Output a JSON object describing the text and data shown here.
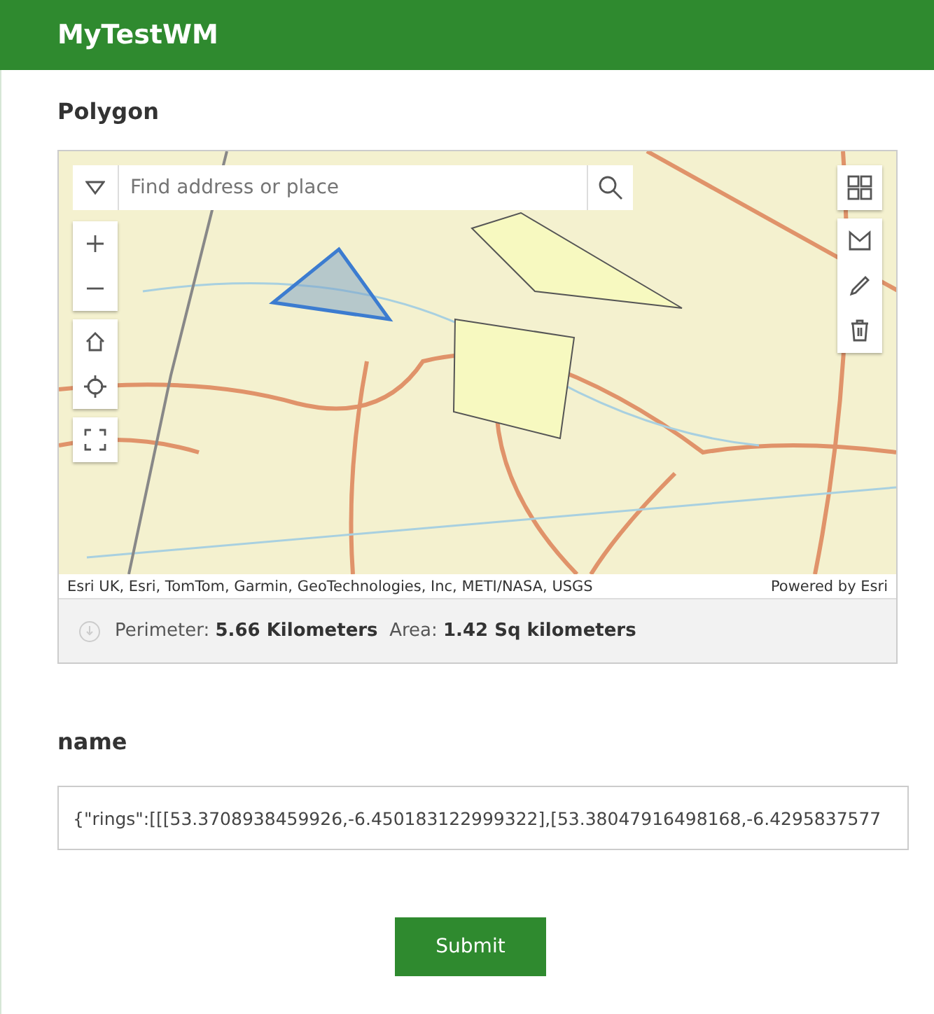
{
  "header": {
    "title": "MyTestWM"
  },
  "map_section": {
    "title": "Polygon",
    "search": {
      "placeholder": "Find address or place"
    },
    "attribution": "Esri UK, Esri, TomTom, Garmin, GeoTechnologies, Inc, METI/NASA, USGS",
    "powered_by": "Powered by Esri",
    "measurement": {
      "perimeter_label": "Perimeter:",
      "perimeter_value": "5.66 Kilometers",
      "area_label": "Area:",
      "area_value": "1.42 Sq kilometers"
    }
  },
  "name_field": {
    "label": "name",
    "value": "{\"rings\":[[[53.3708938459926,-6.450183122999322],[53.38047916498168,-6.4295837577"
  },
  "submit": {
    "label": "Submit"
  }
}
